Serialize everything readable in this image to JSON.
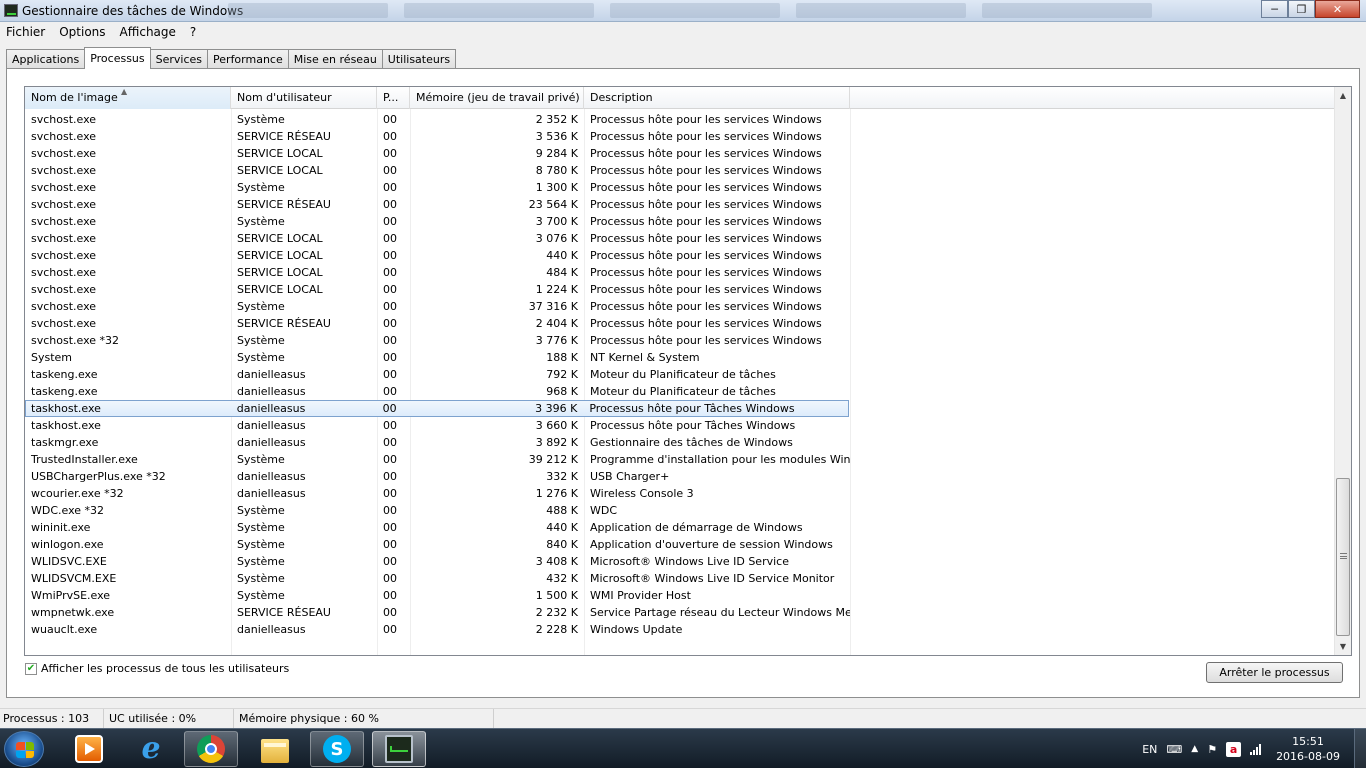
{
  "window": {
    "title": "Gestionnaire des tâches de Windows",
    "minimize": "─",
    "maximize": "❐",
    "close": "✕"
  },
  "menu": [
    "Fichier",
    "Options",
    "Affichage",
    "?"
  ],
  "tabs": [
    "Applications",
    "Processus",
    "Services",
    "Performance",
    "Mise en réseau",
    "Utilisateurs"
  ],
  "active_tab": "Processus",
  "columns": [
    "Nom de l'image",
    "Nom d'utilisateur",
    "P...",
    "Mémoire (jeu de travail privé)",
    "Description"
  ],
  "rows": [
    [
      "svchost.exe",
      "Système",
      "00",
      "2 352 K",
      "Processus hôte pour les services Windows"
    ],
    [
      "svchost.exe",
      "SERVICE RÉSEAU",
      "00",
      "3 536 K",
      "Processus hôte pour les services Windows"
    ],
    [
      "svchost.exe",
      "SERVICE LOCAL",
      "00",
      "9 284 K",
      "Processus hôte pour les services Windows"
    ],
    [
      "svchost.exe",
      "SERVICE LOCAL",
      "00",
      "8 780 K",
      "Processus hôte pour les services Windows"
    ],
    [
      "svchost.exe",
      "Système",
      "00",
      "1 300 K",
      "Processus hôte pour les services Windows"
    ],
    [
      "svchost.exe",
      "SERVICE RÉSEAU",
      "00",
      "23 564 K",
      "Processus hôte pour les services Windows"
    ],
    [
      "svchost.exe",
      "Système",
      "00",
      "3 700 K",
      "Processus hôte pour les services Windows"
    ],
    [
      "svchost.exe",
      "SERVICE LOCAL",
      "00",
      "3 076 K",
      "Processus hôte pour les services Windows"
    ],
    [
      "svchost.exe",
      "SERVICE LOCAL",
      "00",
      "440 K",
      "Processus hôte pour les services Windows"
    ],
    [
      "svchost.exe",
      "SERVICE LOCAL",
      "00",
      "484 K",
      "Processus hôte pour les services Windows"
    ],
    [
      "svchost.exe",
      "SERVICE LOCAL",
      "00",
      "1 224 K",
      "Processus hôte pour les services Windows"
    ],
    [
      "svchost.exe",
      "Système",
      "00",
      "37 316 K",
      "Processus hôte pour les services Windows"
    ],
    [
      "svchost.exe",
      "SERVICE RÉSEAU",
      "00",
      "2 404 K",
      "Processus hôte pour les services Windows"
    ],
    [
      "svchost.exe *32",
      "Système",
      "00",
      "3 776 K",
      "Processus hôte pour les services Windows"
    ],
    [
      "System",
      "Système",
      "00",
      "188 K",
      "NT Kernel & System"
    ],
    [
      "taskeng.exe",
      "danielleasus",
      "00",
      "792 K",
      "Moteur du Planificateur de tâches"
    ],
    [
      "taskeng.exe",
      "danielleasus",
      "00",
      "968 K",
      "Moteur du Planificateur de tâches"
    ],
    [
      "taskhost.exe",
      "danielleasus",
      "00",
      "3 396 K",
      "Processus hôte pour Tâches Windows"
    ],
    [
      "taskhost.exe",
      "danielleasus",
      "00",
      "3 660 K",
      "Processus hôte pour Tâches Windows"
    ],
    [
      "taskmgr.exe",
      "danielleasus",
      "00",
      "3 892 K",
      "Gestionnaire des tâches de Windows"
    ],
    [
      "TrustedInstaller.exe",
      "Système",
      "00",
      "39 212 K",
      "Programme d'installation pour les modules Windows"
    ],
    [
      "USBChargerPlus.exe *32",
      "danielleasus",
      "00",
      "332 K",
      "USB Charger+"
    ],
    [
      "wcourier.exe *32",
      "danielleasus",
      "00",
      "1 276 K",
      "Wireless Console 3"
    ],
    [
      "WDC.exe *32",
      "Système",
      "00",
      "488 K",
      "WDC"
    ],
    [
      "wininit.exe",
      "Système",
      "00",
      "440 K",
      "Application de démarrage de Windows"
    ],
    [
      "winlogon.exe",
      "Système",
      "00",
      "840 K",
      "Application d'ouverture de session Windows"
    ],
    [
      "WLIDSVC.EXE",
      "Système",
      "00",
      "3 408 K",
      "Microsoft® Windows Live ID Service"
    ],
    [
      "WLIDSVCM.EXE",
      "Système",
      "00",
      "432 K",
      "Microsoft® Windows Live ID Service Monitor"
    ],
    [
      "WmiPrvSE.exe",
      "Système",
      "00",
      "1 500 K",
      "WMI Provider Host"
    ],
    [
      "wmpnetwk.exe",
      "SERVICE RÉSEAU",
      "00",
      "2 232 K",
      "Service Partage réseau du Lecteur Windows Media"
    ],
    [
      "wuauclt.exe",
      "danielleasus",
      "00",
      "2 228 K",
      "Windows Update"
    ]
  ],
  "selected_row": 17,
  "show_all_users": {
    "label": "Afficher les processus de tous les utilisateurs",
    "checked": true
  },
  "end_process_button": "Arrêter le processus",
  "status": {
    "processes": "Processus : 103",
    "cpu": "UC utilisée : 0%",
    "memory": "Mémoire physique : 60 %"
  },
  "taskbar": {
    "apps": [
      "media-player-icon",
      "internet-explorer-icon",
      "chrome-icon",
      "file-explorer-icon",
      "skype-icon",
      "task-manager-icon"
    ],
    "language": "EN",
    "time": "15:51",
    "date": "2016-08-09"
  },
  "colors": {
    "selection": "#dcebfb",
    "selection_border": "#7da2ce",
    "taskbar": "#1a2530"
  }
}
